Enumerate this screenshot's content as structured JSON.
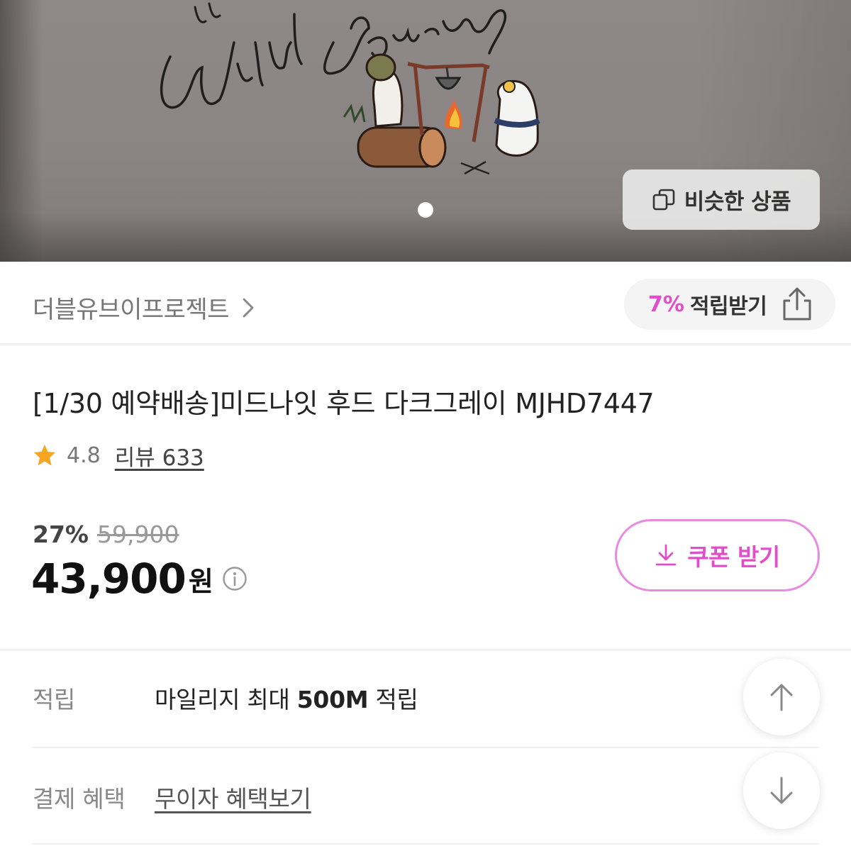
{
  "hero": {
    "similar_button_label": "비슷한 상품",
    "embroidery_text": "the Wird Journey",
    "carousel_pages": 1,
    "carousel_active": 1
  },
  "brand": {
    "name": "더블유브이프로젝트",
    "reward_percent": "7%",
    "reward_label": "적립받기"
  },
  "product": {
    "title": "[1/30 예약배송]미드나잇 후드 다크그레이 MJHD7447",
    "rating": "4.8",
    "review_label": "리뷰 633"
  },
  "price": {
    "discount_rate": "27%",
    "original_price": "59,900",
    "sale_price": "43,900",
    "currency": "원",
    "coupon_label": "쿠폰 받기"
  },
  "benefits": [
    {
      "key": "적립",
      "value_prefix": "마일리지 최대 ",
      "value_bold": "500M",
      "value_suffix": " 적립"
    },
    {
      "key": "결제 혜택",
      "value": "무이자 혜택보기"
    }
  ],
  "colors": {
    "accent_pink": "#e04fc9",
    "coupon_border": "#e88ae0",
    "star": "#f5a623"
  },
  "icons": [
    "copy-icon",
    "chevron-right-icon",
    "share-icon",
    "star-icon",
    "info-icon",
    "download-icon",
    "arrow-up-icon",
    "arrow-down-icon"
  ]
}
